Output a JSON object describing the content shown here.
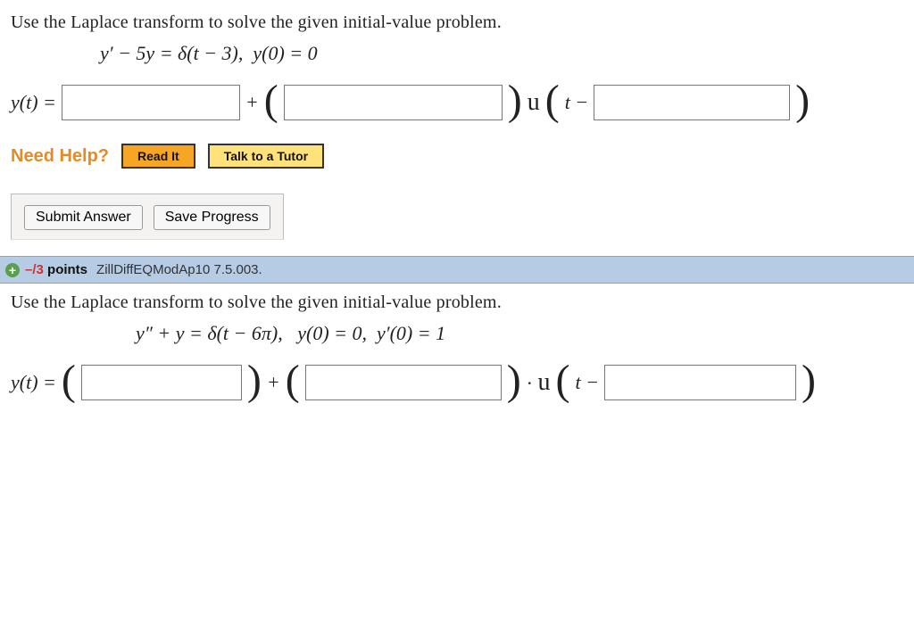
{
  "q1": {
    "prompt": "Use the Laplace transform to solve the given initial-value problem.",
    "equation_html": "y′ − 5y = δ(t − 3),  y(0) = 0",
    "answer_prefix": "y(t) =",
    "plus": "+",
    "lparen": "(",
    "rparen_u": ")",
    "u_label": "u",
    "t_minus": "t −",
    "help_label": "Need Help?",
    "read_it": "Read It",
    "talk_tutor": "Talk to a Tutor",
    "submit": "Submit Answer",
    "save": "Save Progress"
  },
  "bar": {
    "plus": "+",
    "neg": "–/3",
    "points": " points",
    "qid": "ZillDiffEQModAp10 7.5.003."
  },
  "q2": {
    "prompt": "Use the Laplace transform to solve the given initial-value problem.",
    "equation_html": "y″ + y = δ(t − 6π),   y(0) = 0,  y′(0) = 1",
    "answer_prefix": "y(t) =",
    "lparen": "(",
    "rparen": ")",
    "plus": "+",
    "dot_u": "· u",
    "t_minus": "t −"
  }
}
